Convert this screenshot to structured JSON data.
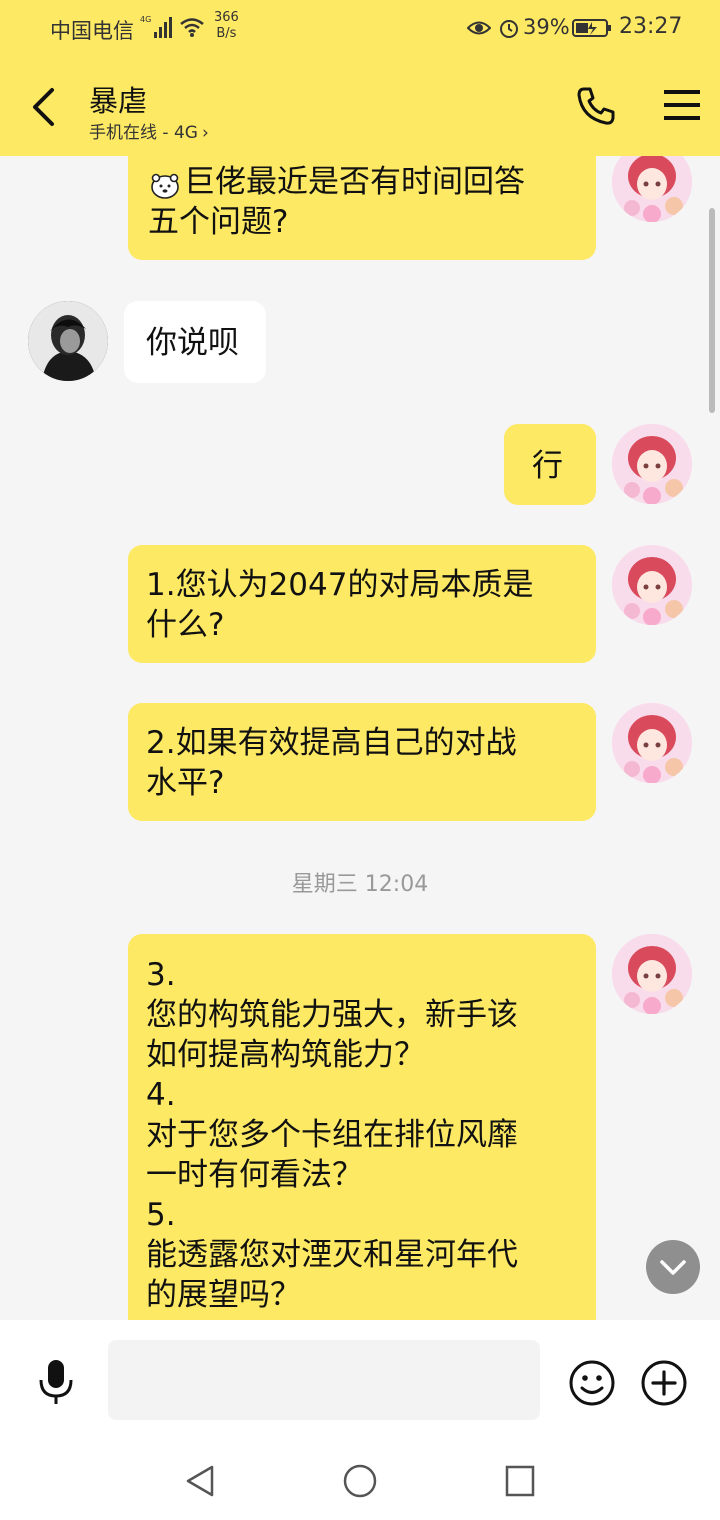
{
  "status_bar": {
    "carrier": "中国电信",
    "network_type": "4G",
    "speed_value": "366",
    "speed_unit": "B/s",
    "battery": "39%",
    "time": "23:27"
  },
  "header": {
    "title": "暴虐",
    "subtitle": "手机在线 - 4G",
    "subtitle_chevron": "›"
  },
  "messages": [
    {
      "side": "right",
      "text": "巨佬最近是否有时间回答\n五个问题?"
    },
    {
      "side": "left",
      "text": "你说呗"
    },
    {
      "side": "right",
      "text": "行"
    },
    {
      "side": "right",
      "text": "1.您认为2047的对局本质是\n什么?"
    },
    {
      "side": "right",
      "text": "2.如果有效提高自己的对战\n水平?"
    },
    {
      "side": "right",
      "text": "3.\n您的构筑能力强大，新手该\n如何提高构筑能力？\n4.\n对于您多个卡组在排位风靡\n一时有何看法？\n5.\n能透露您对湮灭和星河年代\n的展望吗？"
    }
  ],
  "time_separator": "星期三 12:04",
  "input_bar": {
    "placeholder": ""
  },
  "colors": {
    "accent": "#fde964",
    "background": "#f5f5f5"
  },
  "icons": [
    "back-arrow-icon",
    "phone-icon",
    "menu-icon",
    "microphone-icon",
    "emoji-icon",
    "plus-icon",
    "chevron-down-icon",
    "bear-emoji-icon"
  ]
}
